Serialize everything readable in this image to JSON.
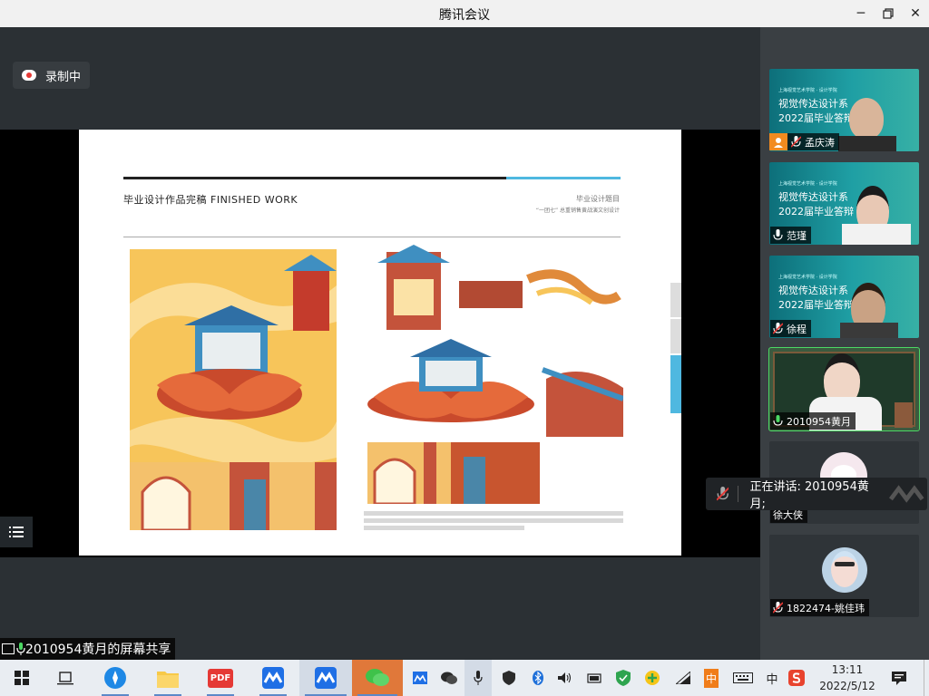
{
  "window": {
    "title": "腾讯会议"
  },
  "recording": {
    "label": "录制中"
  },
  "slide": {
    "heading": "毕业设计作品完稿  FINISHED WORK",
    "right_title": "毕业设计题目",
    "right_sub": "“一团七” 总重销售黄战演文创设计"
  },
  "share": {
    "label": "2010954黄月的屏幕共享"
  },
  "participants": [
    {
      "name": "孟庆涛"
    },
    {
      "name": "范瑾"
    },
    {
      "name": "徐程"
    },
    {
      "name": "2010954黄月"
    },
    {
      "name": "徐大侠"
    },
    {
      "name": "1822474-姚佳玮"
    }
  ],
  "slide_preview": {
    "line1": "上海视觉艺术学院 · 设计学院",
    "line2": "视觉传达设计系",
    "line3": "2022届毕业答辩"
  },
  "speaking": {
    "text": "正在讲话: 2010954黄月;"
  },
  "taskbar": {
    "time": "13:11",
    "date": "2022/5/12",
    "ime": "中",
    "ime2": "中",
    "pdf": "PDF"
  },
  "colors": {
    "accent_cyan": "#4fb8e0",
    "speaking_green": "#4cd964",
    "mute_red": "#e53935",
    "art_orange": "#f7c55a"
  },
  "icons": [
    "cloud-record-icon",
    "menu-list-icon",
    "mic-icon",
    "mic-muted-icon",
    "windows-start-icon",
    "task-view-icon",
    "file-explorer-icon",
    "tencent-meeting-icon",
    "wechat-icon",
    "clock-icon"
  ]
}
